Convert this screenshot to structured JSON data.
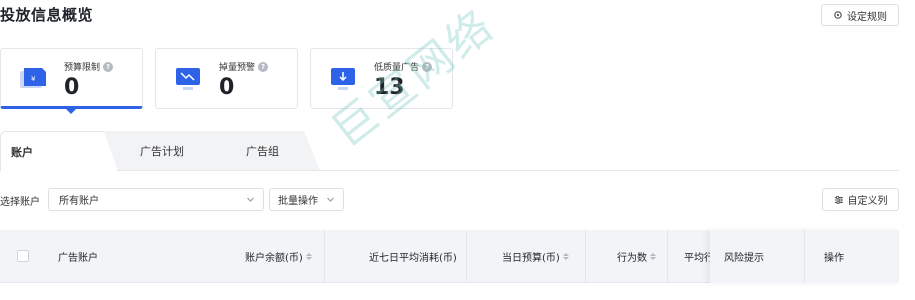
{
  "page": {
    "title": "投放信息概览",
    "rules_button": "设定规则",
    "watermark": "巨宣网络"
  },
  "cards": [
    {
      "label": "预算限制",
      "value": "0",
      "icon": "budget-icon",
      "active": true
    },
    {
      "label": "掉量预警",
      "value": "0",
      "icon": "drop-alert-icon",
      "active": false
    },
    {
      "label": "低质量广告",
      "value": "13",
      "icon": "low-quality-icon",
      "active": false
    }
  ],
  "tabs": [
    {
      "label": "账户"
    },
    {
      "label": "广告计划"
    },
    {
      "label": "广告组"
    }
  ],
  "filters": {
    "account_label": "选择账户",
    "account_value": "所有账户",
    "batch_value": "批量操作",
    "custom_columns": "自定义列"
  },
  "table": {
    "headers": [
      "广告账户",
      "账户余额(币)",
      "近七日平均消耗(币)",
      "当日预算(币)",
      "行为数",
      "平均行",
      "风险提示",
      "操作"
    ]
  },
  "colors": {
    "accent": "#2e63e8",
    "icon_blue": "#2e63e8"
  }
}
